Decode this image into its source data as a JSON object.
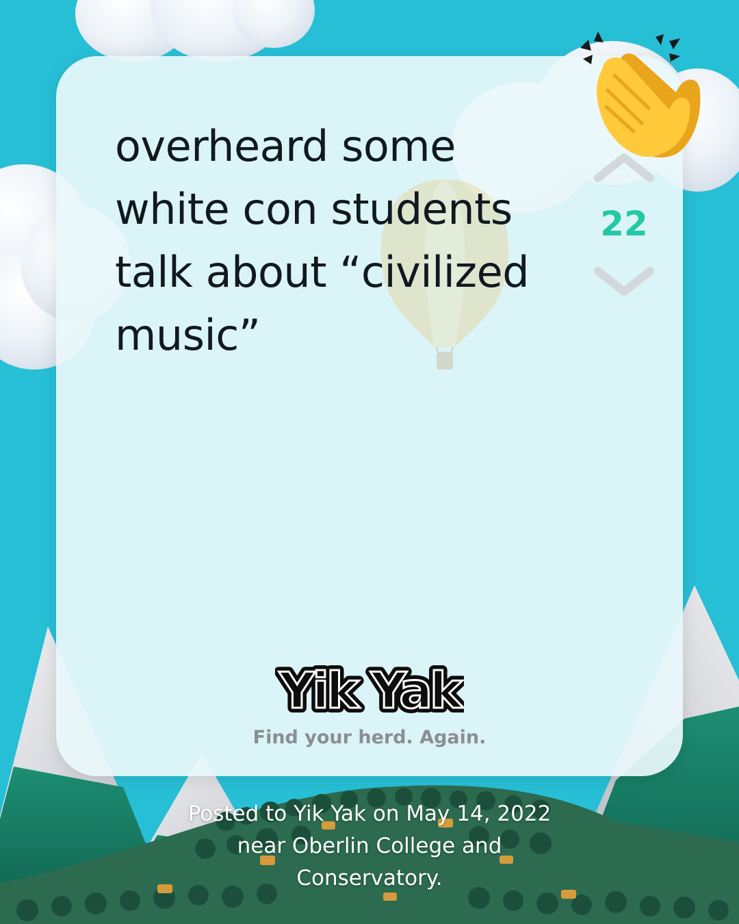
{
  "post": {
    "lines": [
      "overheard some",
      "white con students",
      "talk about “civilized",
      "music”"
    ],
    "vote_count": "22"
  },
  "brand": {
    "logo_text": "Yik Yak",
    "tagline": "Find your herd. Again."
  },
  "footer": {
    "lines": [
      "Posted to Yik Yak on May 14, 2022",
      "near Oberlin College and",
      "Conservatory."
    ]
  },
  "colors": {
    "sky": "#27bfd6",
    "vote_count": "#23c9a4",
    "text": "#101820",
    "tagline": "#8a8f94"
  },
  "icons": {
    "upvote": "chevron-up-icon",
    "downvote": "chevron-down-icon",
    "reaction": "clapping-hands-icon"
  }
}
